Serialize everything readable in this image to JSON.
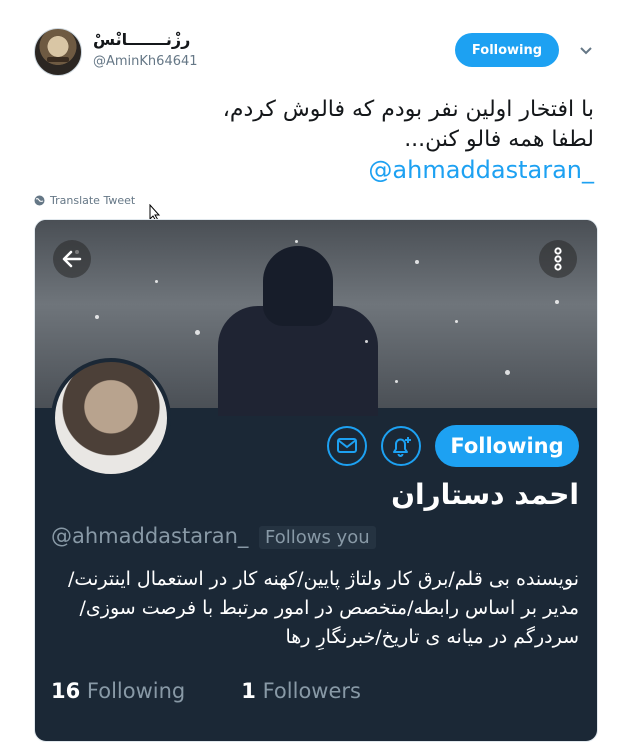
{
  "tweet": {
    "author_name": "رزْنـــــــانْسْ",
    "author_handle": "@AminKh64641",
    "follow_label": "Following",
    "text_line1": "با افتخار اولین نفر بودم که فالوش کردم،",
    "text_line2": "لطفا همه فالو کنن...",
    "mention": "@ahmaddastaran_",
    "translate_label": "Translate Tweet"
  },
  "card": {
    "follow_label": "Following",
    "name": "احمد دستاران",
    "handle": "@ahmaddastaran_",
    "follows_you": "Follows you",
    "bio": "نویسنده بی قلم/برق کار ولتاژ پایین/کهنه کار در استعمال اینترنت/مدیر بر اساس رابطه/متخصص در امور مرتبط با فرصت سوزی/سردرگم در میانه ی تاریخ/خبرنگارِ رها",
    "following_count": "16",
    "following_label": "Following",
    "followers_count": "1",
    "followers_label": "Followers"
  },
  "colors": {
    "accent": "#1da1f2",
    "card_bg": "#1b2836",
    "muted": "#8899a6"
  },
  "icons": [
    "caret-down-icon",
    "globe-icon",
    "back-arrow-icon",
    "more-vertical-icon",
    "mail-icon",
    "bell-plus-icon",
    "mouse-cursor-icon"
  ]
}
